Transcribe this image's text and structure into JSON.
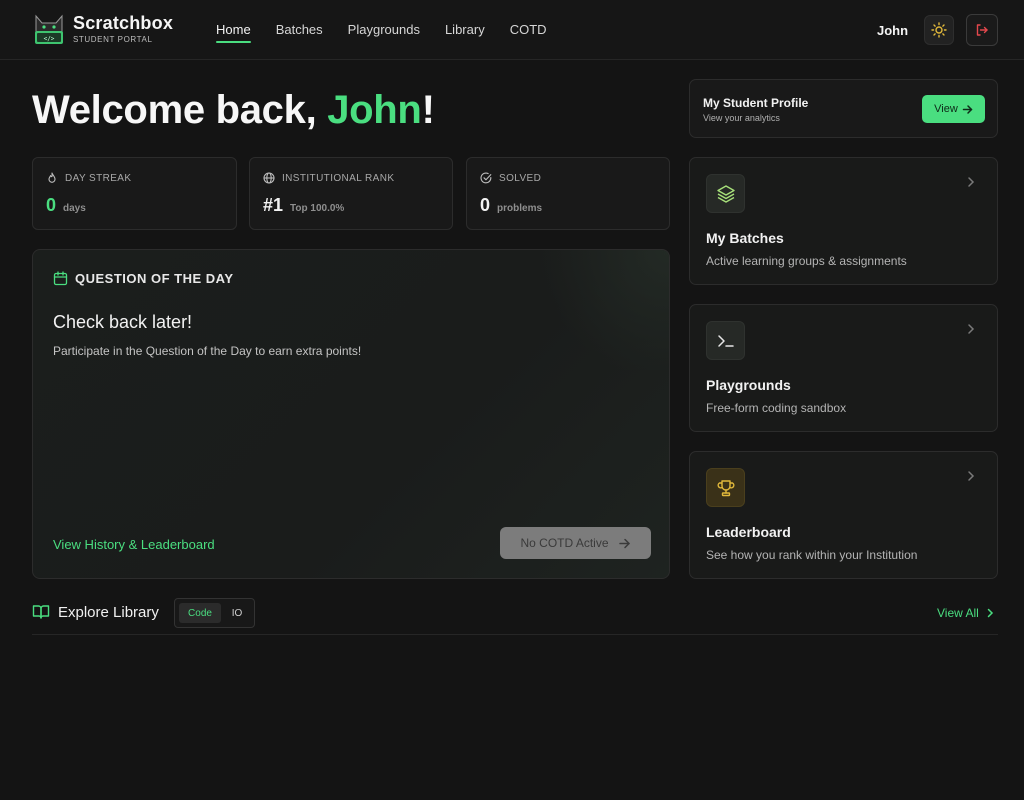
{
  "brand": {
    "name": "Scratchbox",
    "subtitle": "STUDENT PORTAL"
  },
  "nav": {
    "items": [
      {
        "label": "Home",
        "active": true
      },
      {
        "label": "Batches",
        "active": false
      },
      {
        "label": "Playgrounds",
        "active": false
      },
      {
        "label": "Library",
        "active": false
      },
      {
        "label": "COTD",
        "active": false
      }
    ],
    "user": "John"
  },
  "welcome": {
    "prefix": "Welcome back, ",
    "name": "John",
    "suffix": "!"
  },
  "stats": {
    "streak": {
      "label": "DAY STREAK",
      "value": "0",
      "unit": "days"
    },
    "rank": {
      "label": "INSTITUTIONAL RANK",
      "value": "#1",
      "unit": "Top 100.0%"
    },
    "solved": {
      "label": "SOLVED",
      "value": "0",
      "unit": "problems"
    }
  },
  "qotd": {
    "heading": "QUESTION OF THE DAY",
    "title": "Check back later!",
    "description": "Participate in the Question of the Day to earn extra points!",
    "link": "View History & Leaderboard",
    "button": "No COTD Active"
  },
  "profile": {
    "title": "My Student Profile",
    "subtitle": "View your analytics",
    "button": "View"
  },
  "features": [
    {
      "title": "My Batches",
      "description": "Active learning groups & assignments"
    },
    {
      "title": "Playgrounds",
      "description": "Free-form coding sandbox"
    },
    {
      "title": "Leaderboard",
      "description": "See how you rank within your Institution"
    }
  ],
  "library": {
    "title": "Explore Library",
    "toggle": [
      "Code",
      "IO"
    ],
    "view_all": "View All"
  },
  "colors": {
    "accent": "#4ade80",
    "background": "#141414",
    "card": "#191919",
    "gold": "#e2b93b",
    "danger": "#e5484d"
  }
}
